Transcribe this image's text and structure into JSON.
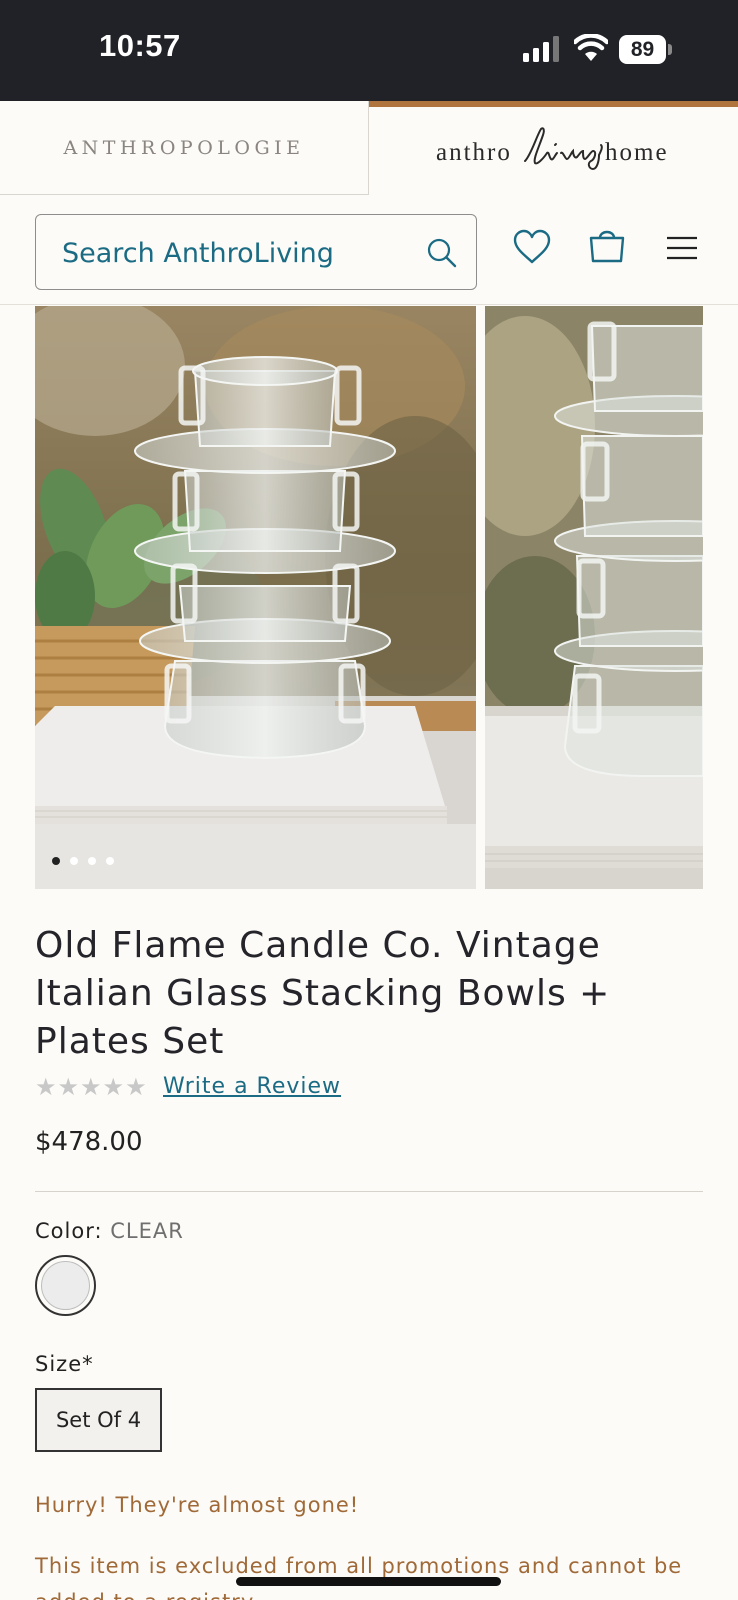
{
  "status_bar": {
    "time": "10:57",
    "battery": "89"
  },
  "brand_tabs": {
    "anthropologie": "ANTHROPOLOGIE",
    "living_left": "anthro",
    "living_script": "living",
    "living_right": "home"
  },
  "search": {
    "placeholder": "Search AnthroLiving"
  },
  "gallery": {
    "slide_count": 4,
    "active_slide": 1
  },
  "product": {
    "title": "Old Flame Candle Co. Vintage Italian Glass Stacking Bowls + Plates Set",
    "rating": {
      "stars": "★★★★★",
      "value": 0,
      "max": 5
    },
    "write_review": "Write a Review",
    "price": "$478.00",
    "color_label": "Color:",
    "color_value": "CLEAR",
    "size_label": "Size*",
    "size_option": "Set Of 4",
    "urgency": "Hurry! They're almost gone!",
    "promo_note": "This item is excluded from all promotions and cannot be added to a registry."
  },
  "colors": {
    "accent": "#1b6b84",
    "brand_bar": "#b0743e",
    "status_bar": "#212227",
    "urgency_text": "#a06a38",
    "background": "#fcfbf7"
  }
}
